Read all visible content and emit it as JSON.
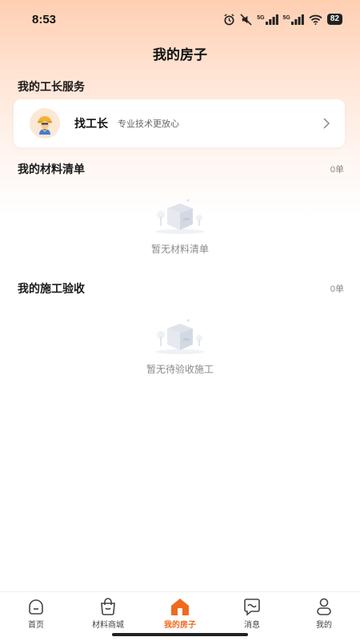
{
  "status_bar": {
    "time": "8:53",
    "battery": "82",
    "signal_label_1": "5G",
    "signal_label_2": "5G"
  },
  "header": {
    "title": "我的房子"
  },
  "foreman": {
    "section_title": "我的工长服务",
    "card_title": "找工长",
    "card_subtitle": "专业技术更放心",
    "avatar_icon": "worker-avatar-icon"
  },
  "materials": {
    "section_title": "我的材料清单",
    "count": "0单",
    "empty_text": "暂无材料清单"
  },
  "inspection": {
    "section_title": "我的施工验收",
    "count": "0单",
    "empty_text": "暂无待验收施工"
  },
  "tabbar": {
    "accent_color": "#ef6a1d",
    "tabs": [
      {
        "label": "首页",
        "icon": "home-face-icon"
      },
      {
        "label": "材料商城",
        "icon": "shopping-bag-icon"
      },
      {
        "label": "我的房子",
        "icon": "house-icon",
        "active": true
      },
      {
        "label": "消息",
        "icon": "message-bubble-icon"
      },
      {
        "label": "我的",
        "icon": "person-icon"
      }
    ]
  }
}
